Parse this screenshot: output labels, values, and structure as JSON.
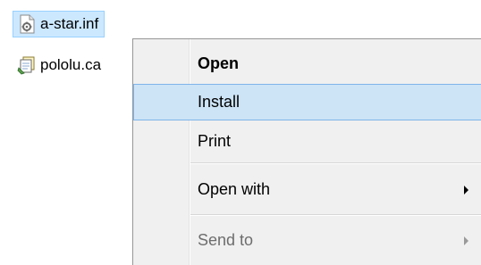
{
  "files": [
    {
      "name": "a-star.inf",
      "icon": "settings-file-icon",
      "selected": true
    },
    {
      "name": "pololu.ca",
      "icon": "catalog-file-icon",
      "selected": false
    }
  ],
  "context_menu": {
    "items": [
      {
        "label": "Open",
        "bold": true,
        "highlighted": false,
        "disabled": false,
        "submenu": false
      },
      {
        "label": "Install",
        "bold": false,
        "highlighted": true,
        "disabled": false,
        "submenu": false
      },
      {
        "label": "Print",
        "bold": false,
        "highlighted": false,
        "disabled": false,
        "submenu": false
      },
      {
        "label": "Open with",
        "bold": false,
        "highlighted": false,
        "disabled": false,
        "submenu": true
      },
      {
        "label": "Send to",
        "bold": false,
        "highlighted": false,
        "disabled": true,
        "submenu": true
      }
    ]
  },
  "colors": {
    "selection_bg": "#cce8ff",
    "menu_bg": "#f0f0f0",
    "menu_highlight": "#cde4f7"
  }
}
